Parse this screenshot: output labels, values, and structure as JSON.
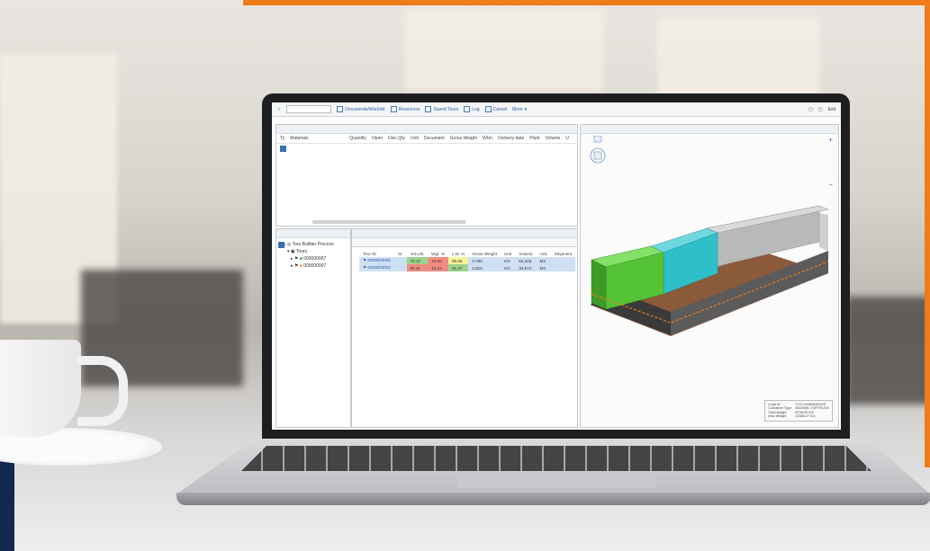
{
  "colors": {
    "accent": "#ee7c1b",
    "navy": "#13294f",
    "green_cargo": "#54c335",
    "teal_cargo": "#2fbfc9",
    "grey_cargo": "#a6a6a6"
  },
  "toolbar": {
    "buttons": [
      "Documents/Worklist",
      "Resources",
      "Saved Tours",
      "Log",
      "Cancel",
      "More"
    ],
    "right": [
      "Exit"
    ]
  },
  "freight_panel": {
    "columns": [
      "Ty",
      "Materials",
      "Quantity",
      "Open",
      "Disc.Qty",
      "Unit",
      "Document",
      "Gross Weight",
      "WUn",
      "Delivery date",
      "Plant",
      "Volume",
      "U"
    ]
  },
  "tree": {
    "root": "Tour Builder Process",
    "child": "Tours",
    "items": [
      "000000007",
      "000000007"
    ]
  },
  "tour_table": {
    "columns": [
      "Tour ID",
      "St.",
      "Vol.Util.",
      "Wgt. %",
      "L.M. %",
      "Gross Weight",
      "Unit",
      "Volume",
      "Unit",
      "Shipment"
    ],
    "rows": [
      [
        "6000000001",
        "",
        "74.12",
        "16.86",
        "95.06",
        "3,786",
        "KG",
        "64,206",
        "M3",
        ""
      ],
      [
        "6000000002",
        "",
        "50.01",
        "10.23",
        "61.47",
        "2,816",
        "KG",
        "34,574",
        "M3",
        ""
      ]
    ]
  },
  "load_info": {
    "rows": [
      [
        "Load ID",
        "TCO 0445083029/S"
      ],
      [
        "Container Type",
        "8600006 / 53FTRUCK"
      ],
      [
        "Total weight",
        "8798.00 KG"
      ],
      [
        "Max Weight",
        "11388.37 KG"
      ]
    ]
  }
}
